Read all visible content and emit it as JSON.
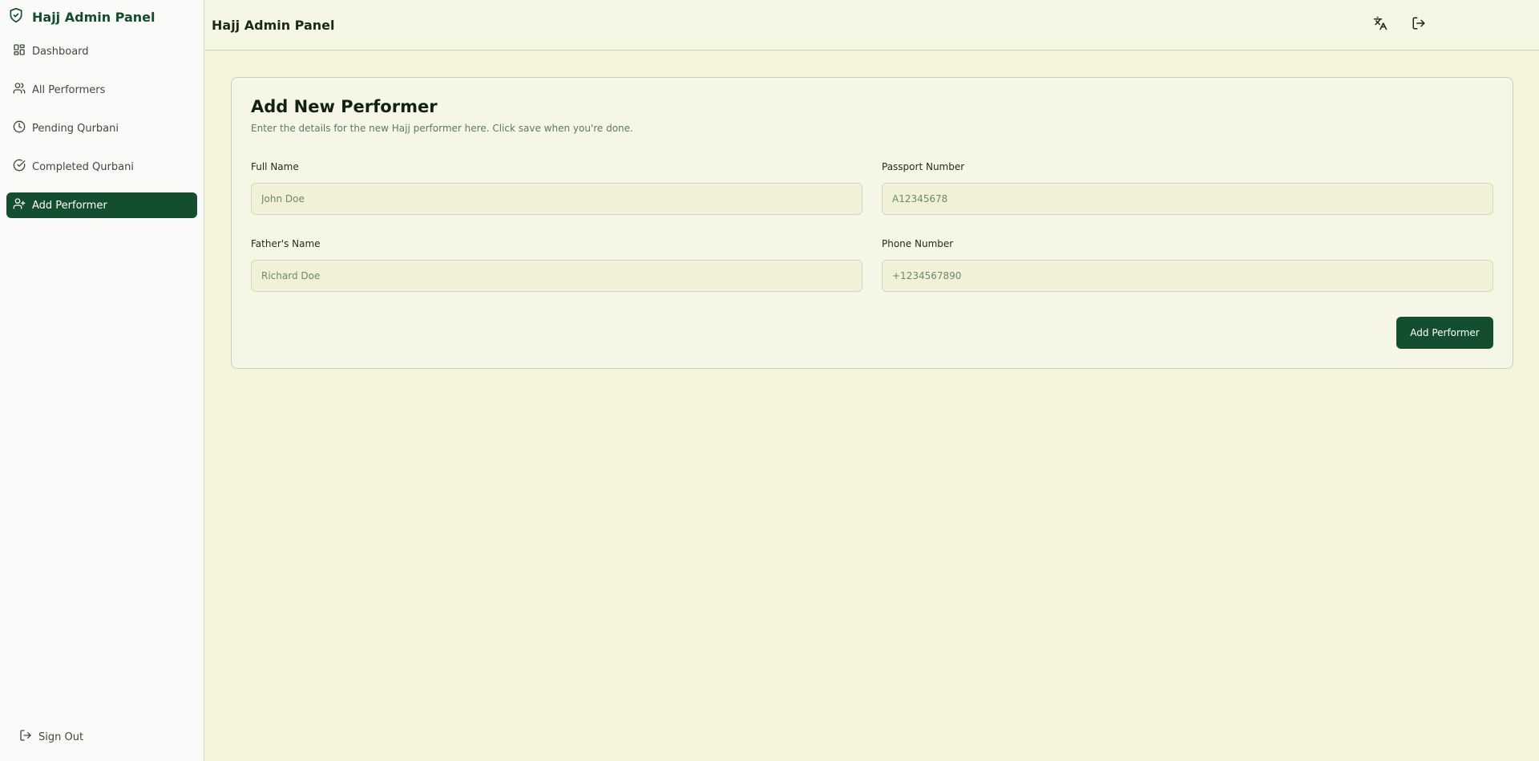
{
  "sidebar": {
    "brand": "Hajj Admin Panel",
    "items": [
      {
        "label": "Dashboard",
        "icon": "dashboard-icon"
      },
      {
        "label": "All Performers",
        "icon": "users-icon"
      },
      {
        "label": "Pending Qurbani",
        "icon": "clock-icon"
      },
      {
        "label": "Completed Qurbani",
        "icon": "check-circle-icon"
      },
      {
        "label": "Add Performer",
        "icon": "user-plus-icon",
        "active": true
      }
    ],
    "signout_label": "Sign Out"
  },
  "header": {
    "title": "Hajj Admin Panel",
    "actions": [
      "translate-icon",
      "logout-icon"
    ]
  },
  "form": {
    "title": "Add New Performer",
    "description": "Enter the details for the new Hajj performer here. Click save when you're done.",
    "fields": [
      {
        "label": "Full Name",
        "placeholder": "John Doe",
        "value": ""
      },
      {
        "label": "Passport Number",
        "placeholder": "A12345678",
        "value": ""
      },
      {
        "label": "Father's Name",
        "placeholder": "Richard Doe",
        "value": ""
      },
      {
        "label": "Phone Number",
        "placeholder": "+1234567890",
        "value": ""
      }
    ],
    "submit_label": "Add Performer"
  },
  "colors": {
    "accent": "#134e2e",
    "background": "#f4f4dc",
    "sidebar": "#fafaf8"
  }
}
